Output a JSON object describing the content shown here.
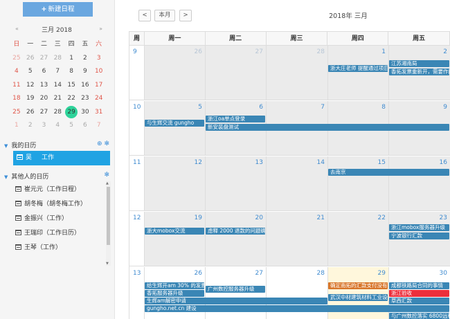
{
  "sidebar": {
    "new_button": "新建日程",
    "mini": {
      "prev": "«",
      "next": "»",
      "title": "三月 2018",
      "weekdays": [
        "日",
        "一",
        "二",
        "三",
        "四",
        "五",
        "六"
      ],
      "rows": [
        [
          "25",
          "26",
          "27",
          "28",
          "1",
          "2",
          "3"
        ],
        [
          "4",
          "5",
          "6",
          "7",
          "8",
          "9",
          "10"
        ],
        [
          "11",
          "12",
          "13",
          "14",
          "15",
          "16",
          "17"
        ],
        [
          "18",
          "19",
          "20",
          "21",
          "22",
          "23",
          "24"
        ],
        [
          "25",
          "26",
          "27",
          "28",
          "29",
          "30",
          "31"
        ],
        [
          "1",
          "2",
          "3",
          "4",
          "5",
          "6",
          "7"
        ]
      ],
      "today": "29"
    },
    "my_cal_title": "我的日历",
    "my_cal_item": {
      "owner": "吴",
      "name": "工作"
    },
    "other_cal_title": "其他人的日历",
    "other_cal_items": [
      "崔元元（工作日程）",
      "胡冬梅（胡冬梅工作）",
      "金振兴（工作）",
      "王瑞印（工作日历）",
      "王琴（工作）"
    ]
  },
  "toolbar": {
    "prev": "<",
    "this_month": "本月",
    "next": ">",
    "title": "2018年 三月"
  },
  "calendar": {
    "headers": [
      "周",
      "周一",
      "周二",
      "周三",
      "周四",
      "周五"
    ],
    "weeks": [
      {
        "week": "9",
        "days": [
          "26",
          "27",
          "28",
          "1",
          "2"
        ]
      },
      {
        "week": "10",
        "days": [
          "5",
          "6",
          "7",
          "8",
          "9"
        ]
      },
      {
        "week": "11",
        "days": [
          "12",
          "13",
          "14",
          "15",
          "16"
        ]
      },
      {
        "week": "12",
        "days": [
          "19",
          "20",
          "21",
          "22",
          "23"
        ]
      },
      {
        "week": "13",
        "days": [
          "26",
          "27",
          "28",
          "29",
          "30"
        ]
      }
    ],
    "events": {
      "e1": "浙大庄老师 提醒通过项目",
      "e2": "江苏湘南局",
      "e3": "香拓发票重新开，需要作废",
      "e4": "浙江oa单点登录",
      "e5": "与生辉交流 gungho",
      "e6": "新安装盘测试",
      "e7": "去南京",
      "e8": "浙大mobox交流",
      "e9": "虑释 2000 退款的问题确认",
      "e10": "浙江mobox服务器升级",
      "e11": "宁波银行汇款",
      "e12": "给生辉开am 30% 的发票",
      "e13": "广州数控服务器升级",
      "e14": "确定南拓的汇款支付没有",
      "e15": "成都铁路局合同的事情",
      "e16": "香拓服务器升级",
      "e17": "浙江验收",
      "e18": "生辉am解密申请",
      "e19": "武汉中材建筑材料工业设计",
      "e20": "草西汇款",
      "e21": "gungho.net.cn 建设",
      "e22": "与广州数控落实 6800远程"
    }
  },
  "colors": {
    "accent": "#20a3e3",
    "event": "#3a86b5",
    "today_circle": "#2ed39a"
  }
}
